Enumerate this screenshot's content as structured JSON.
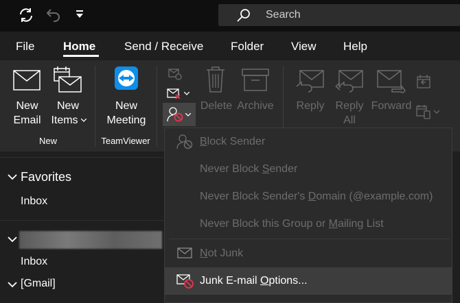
{
  "titlebar": {
    "search_placeholder": "Search",
    "icons": [
      "sync-icon",
      "undo-icon",
      "customize-toolbar-icon",
      "search-icon"
    ]
  },
  "tabs": [
    {
      "label": "File",
      "active": false
    },
    {
      "label": "Home",
      "active": true
    },
    {
      "label": "Send / Receive",
      "active": false
    },
    {
      "label": "Folder",
      "active": false
    },
    {
      "label": "View",
      "active": false
    },
    {
      "label": "Help",
      "active": false
    }
  ],
  "ribbon": {
    "new_email": [
      "New",
      "Email"
    ],
    "new_items": [
      "New",
      "Items"
    ],
    "group_new": "New",
    "new_meeting": [
      "New",
      "Meeting"
    ],
    "group_teamviewer": "TeamViewer",
    "delete": "Delete",
    "archive": "Archive",
    "reply": "Reply",
    "reply_all": [
      "Reply",
      "All"
    ],
    "forward": "Forward"
  },
  "nav": {
    "favorites": "Favorites",
    "inbox1": "Inbox",
    "inbox2": "Inbox",
    "gmail": "[Gmail]"
  },
  "junk_menu": {
    "block_sender": {
      "pre": "",
      "u": "B",
      "post": "lock Sender"
    },
    "never_block_sender": {
      "pre": "Never Block ",
      "u": "S",
      "post": "ender"
    },
    "never_block_domain": {
      "pre": "Never Block Sender's ",
      "u": "D",
      "post": "omain (@example.com)"
    },
    "never_block_group": {
      "pre": "Never Block this Group or ",
      "u": "M",
      "post": "ailing List"
    },
    "not_junk": {
      "pre": "",
      "u": "N",
      "post": "ot Junk"
    },
    "junk_options": {
      "pre": "Junk E-mail ",
      "u": "O",
      "post": "ptions..."
    }
  },
  "colors": {
    "accent_red": "#e8344a",
    "teamviewer_blue": "#0e8ee9"
  }
}
